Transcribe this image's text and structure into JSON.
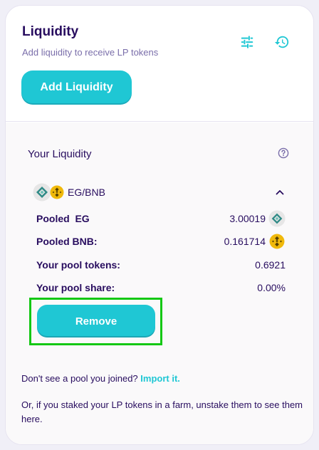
{
  "header": {
    "title": "Liquidity",
    "subtitle": "Add liquidity to receive LP tokens",
    "settings_icon": "settings-sliders-icon",
    "history_icon": "history-icon",
    "add_button_label": "Add Liquidity"
  },
  "your_liquidity": {
    "heading": "Your Liquidity",
    "help_icon": "question-icon",
    "pair": {
      "name": "EG/BNB",
      "token0_icon": "eg-token-icon",
      "token1_icon": "bnb-token-icon"
    },
    "details": [
      {
        "label": "Pooled  EG",
        "value": "3.00019",
        "icon": "eg-token-icon"
      },
      {
        "label": "Pooled BNB:",
        "value": "0.161714",
        "icon": "bnb-token-icon"
      },
      {
        "label": "Your pool tokens:",
        "value": "0.6921"
      },
      {
        "label": "Your pool share:",
        "value": "0.00%"
      }
    ],
    "remove_button_label": "Remove"
  },
  "footer": {
    "import_prompt": "Don't see a pool you joined?",
    "import_link": "Import it.",
    "farm_note": "Or, if you staked your LP tokens in a farm, unstake them to see them here."
  },
  "colors": {
    "primary": "#1fc7d4",
    "text": "#280d5f",
    "secondary_text": "#7a6eaa",
    "highlight": "#14c814",
    "bnb": "#f0b90b",
    "eg": "#3f8f8a"
  }
}
